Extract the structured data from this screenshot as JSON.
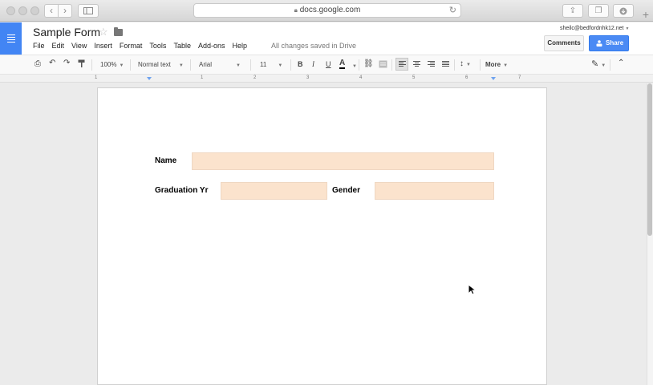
{
  "browser": {
    "url": "docs.google.com"
  },
  "doc": {
    "title": "Sample Form",
    "menu": [
      "File",
      "Edit",
      "View",
      "Insert",
      "Format",
      "Tools",
      "Table",
      "Add-ons",
      "Help"
    ],
    "saved_status": "All changes saved in Drive",
    "user_email": "sheilc@bedfordnhk12.net",
    "comments_label": "Comments",
    "share_label": "Share"
  },
  "toolbar": {
    "zoom": "100%",
    "style": "Normal text",
    "font": "Arial",
    "size": "11",
    "bold": "B",
    "italic": "I",
    "underline": "U",
    "text_color": "A",
    "more_label": "More"
  },
  "ruler": {
    "numbers": [
      "1",
      "1",
      "2",
      "3",
      "4",
      "5",
      "6",
      "7"
    ]
  },
  "form": {
    "name_label": "Name",
    "grad_label": "Graduation Yr",
    "gender_label": "Gender",
    "field_color": "#fbe3cd"
  },
  "colors": {
    "docs_blue": "#4285f4",
    "share_blue": "#4a8af4"
  }
}
